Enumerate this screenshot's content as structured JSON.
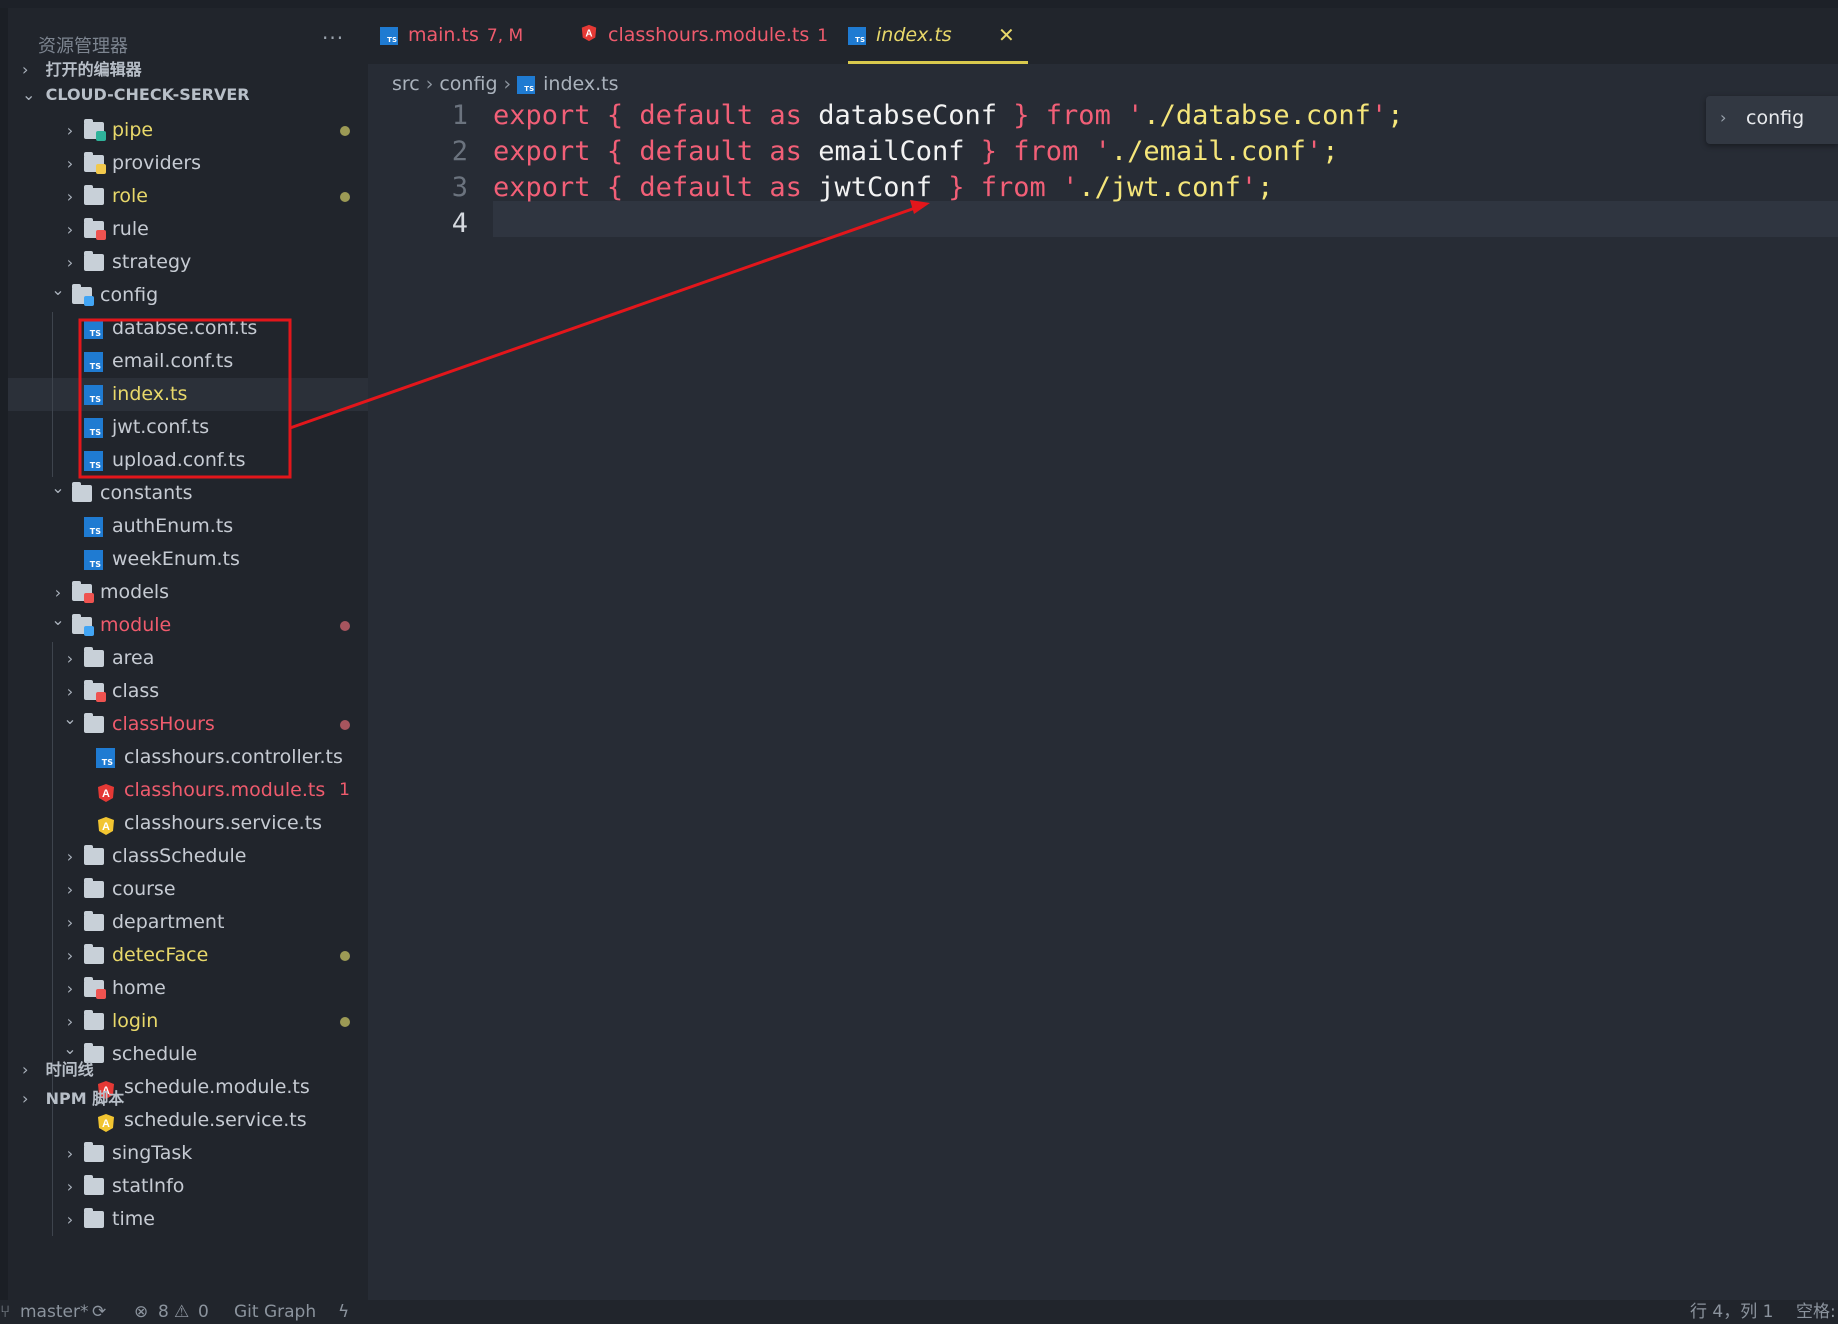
{
  "sidebar": {
    "title": "资源管理器",
    "more": "···",
    "open_editors": "打开的编辑器",
    "root": "CLOUD-CHECK-SERVER",
    "timeline": "时间线",
    "npm": "NPM 脚本",
    "tree": [
      {
        "label": "pipe",
        "depth": 1,
        "type": "folder",
        "expanded": false,
        "color": "#e8d86a",
        "icon": "pipe-folder-icon",
        "iconColor": "#2fb39b",
        "dot": "y"
      },
      {
        "label": "providers",
        "depth": 1,
        "type": "folder",
        "expanded": false,
        "color": "#c6cbd3",
        "icon": "providers-folder-icon",
        "iconColor": "#f2c94c"
      },
      {
        "label": "role",
        "depth": 1,
        "type": "folder",
        "expanded": false,
        "color": "#e8d86a",
        "icon": "folder-icon",
        "iconColor": "#c8d0d8",
        "dot": "y"
      },
      {
        "label": "rule",
        "depth": 1,
        "type": "folder",
        "expanded": false,
        "color": "#c6cbd3",
        "icon": "rule-folder-icon",
        "iconColor": "#ef5350"
      },
      {
        "label": "strategy",
        "depth": 1,
        "type": "folder",
        "expanded": false,
        "color": "#c6cbd3",
        "icon": "folder-icon",
        "iconColor": "#c8d0d8"
      },
      {
        "label": "config",
        "depth": 0,
        "type": "folder",
        "expanded": true,
        "color": "#c6cbd3",
        "icon": "config-folder-icon",
        "iconColor": "#42a5f5"
      },
      {
        "label": "databse.conf.ts",
        "depth": 1,
        "type": "ts",
        "color": "#c6cbd3"
      },
      {
        "label": "email.conf.ts",
        "depth": 1,
        "type": "ts",
        "color": "#c6cbd3"
      },
      {
        "label": "index.ts",
        "depth": 1,
        "type": "ts",
        "color": "#e8d86a",
        "selected": true
      },
      {
        "label": "jwt.conf.ts",
        "depth": 1,
        "type": "ts",
        "color": "#c6cbd3"
      },
      {
        "label": "upload.conf.ts",
        "depth": 1,
        "type": "ts",
        "color": "#c6cbd3"
      },
      {
        "label": "constants",
        "depth": 0,
        "type": "folder",
        "expanded": true,
        "color": "#c6cbd3",
        "icon": "constants-folder-icon",
        "iconColor": "#c8d0d8"
      },
      {
        "label": "authEnum.ts",
        "depth": 1,
        "type": "ts",
        "color": "#c6cbd3"
      },
      {
        "label": "weekEnum.ts",
        "depth": 1,
        "type": "ts",
        "color": "#c6cbd3"
      },
      {
        "label": "models",
        "depth": 0,
        "type": "folder",
        "expanded": false,
        "color": "#c6cbd3",
        "icon": "models-folder-icon",
        "iconColor": "#ef5350"
      },
      {
        "label": "module",
        "depth": 0,
        "type": "folder",
        "expanded": true,
        "color": "#ef5b6d",
        "icon": "module-folder-icon",
        "iconColor": "#42a5f5",
        "dot": "r"
      },
      {
        "label": "area",
        "depth": 1,
        "type": "folder",
        "expanded": false,
        "color": "#c6cbd3",
        "icon": "folder-icon",
        "iconColor": "#c8d0d8"
      },
      {
        "label": "class",
        "depth": 1,
        "type": "folder",
        "expanded": false,
        "color": "#c6cbd3",
        "icon": "class-folder-icon",
        "iconColor": "#ef5350"
      },
      {
        "label": "classHours",
        "depth": 1,
        "type": "folder",
        "expanded": true,
        "color": "#ef5b6d",
        "icon": "open-folder-icon",
        "iconColor": "#c8d0d8",
        "dot": "r"
      },
      {
        "label": "classhours.controller.ts",
        "depth": 2,
        "type": "ts",
        "color": "#c6cbd3"
      },
      {
        "label": "classhours.module.ts",
        "depth": 2,
        "type": "ng-red",
        "color": "#ef5b6d",
        "badge": "1"
      },
      {
        "label": "classhours.service.ts",
        "depth": 2,
        "type": "ng-yellow",
        "color": "#c6cbd3"
      },
      {
        "label": "classSchedule",
        "depth": 1,
        "type": "folder",
        "expanded": false,
        "color": "#c6cbd3",
        "icon": "folder-icon",
        "iconColor": "#c8d0d8"
      },
      {
        "label": "course",
        "depth": 1,
        "type": "folder",
        "expanded": false,
        "color": "#c6cbd3",
        "icon": "folder-icon",
        "iconColor": "#c8d0d8"
      },
      {
        "label": "department",
        "depth": 1,
        "type": "folder",
        "expanded": false,
        "color": "#c6cbd3",
        "icon": "folder-icon",
        "iconColor": "#c8d0d8"
      },
      {
        "label": "detecFace",
        "depth": 1,
        "type": "folder",
        "expanded": false,
        "color": "#e8d86a",
        "icon": "folder-icon",
        "iconColor": "#c8d0d8",
        "dot": "y"
      },
      {
        "label": "home",
        "depth": 1,
        "type": "folder",
        "expanded": false,
        "color": "#c6cbd3",
        "icon": "home-folder-icon",
        "iconColor": "#ef5350"
      },
      {
        "label": "login",
        "depth": 1,
        "type": "folder",
        "expanded": false,
        "color": "#e8d86a",
        "icon": "folder-icon",
        "iconColor": "#c8d0d8",
        "dot": "y"
      },
      {
        "label": "schedule",
        "depth": 1,
        "type": "folder",
        "expanded": true,
        "color": "#c6cbd3",
        "icon": "open-folder-icon",
        "iconColor": "#c8d0d8"
      },
      {
        "label": "schedule.module.ts",
        "depth": 2,
        "type": "ng-red",
        "color": "#c6cbd3"
      },
      {
        "label": "schedule.service.ts",
        "depth": 2,
        "type": "ng-yellow",
        "color": "#c6cbd3"
      },
      {
        "label": "singTask",
        "depth": 1,
        "type": "folder",
        "expanded": false,
        "color": "#c6cbd3",
        "icon": "folder-icon",
        "iconColor": "#c8d0d8"
      },
      {
        "label": "statInfo",
        "depth": 1,
        "type": "folder",
        "expanded": false,
        "color": "#c6cbd3",
        "icon": "folder-icon",
        "iconColor": "#c8d0d8"
      },
      {
        "label": "time",
        "depth": 1,
        "type": "folder",
        "expanded": false,
        "color": "#c6cbd3",
        "icon": "folder-icon",
        "iconColor": "#c8d0d8"
      }
    ]
  },
  "tabs": [
    {
      "label": "main.ts",
      "detail": "7, M",
      "icon": "ts-file-icon",
      "color": "#ef5b6d",
      "italic": false,
      "active": false
    },
    {
      "label": "classhours.module.ts",
      "detail": "1",
      "icon": "angular-icon",
      "color": "#ef5b6d",
      "italic": false,
      "active": false
    },
    {
      "label": "index.ts",
      "detail": "",
      "icon": "ts-file-icon",
      "color": "#e8d86a",
      "italic": true,
      "active": true,
      "close": "✕"
    }
  ],
  "breadcrumbs": {
    "part1": "src",
    "part2": "config",
    "file": "index.ts"
  },
  "code": {
    "line_numbers": [
      "1",
      "2",
      "3",
      "4"
    ],
    "lines": [
      {
        "kw1": "export",
        "ob": "{",
        "kw2": "default",
        "kw3": "as",
        "name": "databseConf",
        "cb": "}",
        "kw4": "from",
        "q1": "'",
        "path": "./databse.conf",
        "q2": "'",
        "semi": ";"
      },
      {
        "kw1": "export",
        "ob": "{",
        "kw2": "default",
        "kw3": "as",
        "name": "emailConf",
        "cb": "}",
        "kw4": "from",
        "q1": "'",
        "path": "./email.conf",
        "q2": "'",
        "semi": ";"
      },
      {
        "kw1": "export",
        "ob": "{",
        "kw2": "default",
        "kw3": "as",
        "name": "jwtConf",
        "cb": "}",
        "kw4": "from",
        "q1": "'",
        "path": "./jwt.conf",
        "q2": "'",
        "semi": ";"
      }
    ]
  },
  "sticky": {
    "label": "config"
  },
  "statusbar": {
    "branch": "master*",
    "sync": "⟳",
    "errors": "8",
    "warnings": "0",
    "gitgraph": "Git Graph",
    "bolt": "ϟ",
    "position": "行 4，列 1",
    "spaces": "空格:"
  },
  "colors": {
    "annotation": "#e3161b",
    "accent": "#d9c94d"
  }
}
